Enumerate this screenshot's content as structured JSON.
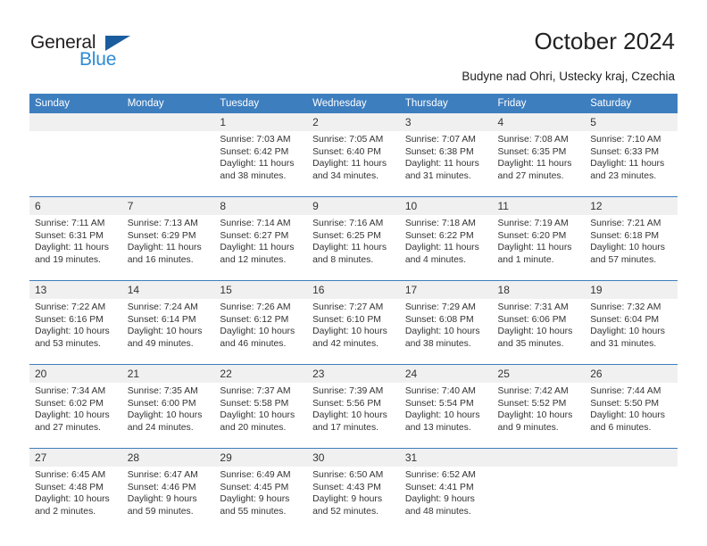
{
  "logo": {
    "word_top": "General",
    "word_bottom": "Blue",
    "triangle_color": "#1a5d9e",
    "blue_text_color": "#2e8bd4"
  },
  "header": {
    "title": "October 2024",
    "subtitle": "Budyne nad Ohri, Ustecky kraj, Czechia"
  },
  "theme": {
    "header_bg": "#3d7ebf",
    "date_strip_bg": "#f0f0f0",
    "text": "#333333"
  },
  "calendar": {
    "weekday_headers": [
      "Sunday",
      "Monday",
      "Tuesday",
      "Wednesday",
      "Thursday",
      "Friday",
      "Saturday"
    ],
    "weeks": [
      [
        {
          "day": "",
          "sunrise": "",
          "sunset": "",
          "daylight_1": "",
          "daylight_2": ""
        },
        {
          "day": "",
          "sunrise": "",
          "sunset": "",
          "daylight_1": "",
          "daylight_2": ""
        },
        {
          "day": "1",
          "sunrise": "Sunrise: 7:03 AM",
          "sunset": "Sunset: 6:42 PM",
          "daylight_1": "Daylight: 11 hours",
          "daylight_2": "and 38 minutes."
        },
        {
          "day": "2",
          "sunrise": "Sunrise: 7:05 AM",
          "sunset": "Sunset: 6:40 PM",
          "daylight_1": "Daylight: 11 hours",
          "daylight_2": "and 34 minutes."
        },
        {
          "day": "3",
          "sunrise": "Sunrise: 7:07 AM",
          "sunset": "Sunset: 6:38 PM",
          "daylight_1": "Daylight: 11 hours",
          "daylight_2": "and 31 minutes."
        },
        {
          "day": "4",
          "sunrise": "Sunrise: 7:08 AM",
          "sunset": "Sunset: 6:35 PM",
          "daylight_1": "Daylight: 11 hours",
          "daylight_2": "and 27 minutes."
        },
        {
          "day": "5",
          "sunrise": "Sunrise: 7:10 AM",
          "sunset": "Sunset: 6:33 PM",
          "daylight_1": "Daylight: 11 hours",
          "daylight_2": "and 23 minutes."
        }
      ],
      [
        {
          "day": "6",
          "sunrise": "Sunrise: 7:11 AM",
          "sunset": "Sunset: 6:31 PM",
          "daylight_1": "Daylight: 11 hours",
          "daylight_2": "and 19 minutes."
        },
        {
          "day": "7",
          "sunrise": "Sunrise: 7:13 AM",
          "sunset": "Sunset: 6:29 PM",
          "daylight_1": "Daylight: 11 hours",
          "daylight_2": "and 16 minutes."
        },
        {
          "day": "8",
          "sunrise": "Sunrise: 7:14 AM",
          "sunset": "Sunset: 6:27 PM",
          "daylight_1": "Daylight: 11 hours",
          "daylight_2": "and 12 minutes."
        },
        {
          "day": "9",
          "sunrise": "Sunrise: 7:16 AM",
          "sunset": "Sunset: 6:25 PM",
          "daylight_1": "Daylight: 11 hours",
          "daylight_2": "and 8 minutes."
        },
        {
          "day": "10",
          "sunrise": "Sunrise: 7:18 AM",
          "sunset": "Sunset: 6:22 PM",
          "daylight_1": "Daylight: 11 hours",
          "daylight_2": "and 4 minutes."
        },
        {
          "day": "11",
          "sunrise": "Sunrise: 7:19 AM",
          "sunset": "Sunset: 6:20 PM",
          "daylight_1": "Daylight: 11 hours",
          "daylight_2": "and 1 minute."
        },
        {
          "day": "12",
          "sunrise": "Sunrise: 7:21 AM",
          "sunset": "Sunset: 6:18 PM",
          "daylight_1": "Daylight: 10 hours",
          "daylight_2": "and 57 minutes."
        }
      ],
      [
        {
          "day": "13",
          "sunrise": "Sunrise: 7:22 AM",
          "sunset": "Sunset: 6:16 PM",
          "daylight_1": "Daylight: 10 hours",
          "daylight_2": "and 53 minutes."
        },
        {
          "day": "14",
          "sunrise": "Sunrise: 7:24 AM",
          "sunset": "Sunset: 6:14 PM",
          "daylight_1": "Daylight: 10 hours",
          "daylight_2": "and 49 minutes."
        },
        {
          "day": "15",
          "sunrise": "Sunrise: 7:26 AM",
          "sunset": "Sunset: 6:12 PM",
          "daylight_1": "Daylight: 10 hours",
          "daylight_2": "and 46 minutes."
        },
        {
          "day": "16",
          "sunrise": "Sunrise: 7:27 AM",
          "sunset": "Sunset: 6:10 PM",
          "daylight_1": "Daylight: 10 hours",
          "daylight_2": "and 42 minutes."
        },
        {
          "day": "17",
          "sunrise": "Sunrise: 7:29 AM",
          "sunset": "Sunset: 6:08 PM",
          "daylight_1": "Daylight: 10 hours",
          "daylight_2": "and 38 minutes."
        },
        {
          "day": "18",
          "sunrise": "Sunrise: 7:31 AM",
          "sunset": "Sunset: 6:06 PM",
          "daylight_1": "Daylight: 10 hours",
          "daylight_2": "and 35 minutes."
        },
        {
          "day": "19",
          "sunrise": "Sunrise: 7:32 AM",
          "sunset": "Sunset: 6:04 PM",
          "daylight_1": "Daylight: 10 hours",
          "daylight_2": "and 31 minutes."
        }
      ],
      [
        {
          "day": "20",
          "sunrise": "Sunrise: 7:34 AM",
          "sunset": "Sunset: 6:02 PM",
          "daylight_1": "Daylight: 10 hours",
          "daylight_2": "and 27 minutes."
        },
        {
          "day": "21",
          "sunrise": "Sunrise: 7:35 AM",
          "sunset": "Sunset: 6:00 PM",
          "daylight_1": "Daylight: 10 hours",
          "daylight_2": "and 24 minutes."
        },
        {
          "day": "22",
          "sunrise": "Sunrise: 7:37 AM",
          "sunset": "Sunset: 5:58 PM",
          "daylight_1": "Daylight: 10 hours",
          "daylight_2": "and 20 minutes."
        },
        {
          "day": "23",
          "sunrise": "Sunrise: 7:39 AM",
          "sunset": "Sunset: 5:56 PM",
          "daylight_1": "Daylight: 10 hours",
          "daylight_2": "and 17 minutes."
        },
        {
          "day": "24",
          "sunrise": "Sunrise: 7:40 AM",
          "sunset": "Sunset: 5:54 PM",
          "daylight_1": "Daylight: 10 hours",
          "daylight_2": "and 13 minutes."
        },
        {
          "day": "25",
          "sunrise": "Sunrise: 7:42 AM",
          "sunset": "Sunset: 5:52 PM",
          "daylight_1": "Daylight: 10 hours",
          "daylight_2": "and 9 minutes."
        },
        {
          "day": "26",
          "sunrise": "Sunrise: 7:44 AM",
          "sunset": "Sunset: 5:50 PM",
          "daylight_1": "Daylight: 10 hours",
          "daylight_2": "and 6 minutes."
        }
      ],
      [
        {
          "day": "27",
          "sunrise": "Sunrise: 6:45 AM",
          "sunset": "Sunset: 4:48 PM",
          "daylight_1": "Daylight: 10 hours",
          "daylight_2": "and 2 minutes."
        },
        {
          "day": "28",
          "sunrise": "Sunrise: 6:47 AM",
          "sunset": "Sunset: 4:46 PM",
          "daylight_1": "Daylight: 9 hours",
          "daylight_2": "and 59 minutes."
        },
        {
          "day": "29",
          "sunrise": "Sunrise: 6:49 AM",
          "sunset": "Sunset: 4:45 PM",
          "daylight_1": "Daylight: 9 hours",
          "daylight_2": "and 55 minutes."
        },
        {
          "day": "30",
          "sunrise": "Sunrise: 6:50 AM",
          "sunset": "Sunset: 4:43 PM",
          "daylight_1": "Daylight: 9 hours",
          "daylight_2": "and 52 minutes."
        },
        {
          "day": "31",
          "sunrise": "Sunrise: 6:52 AM",
          "sunset": "Sunset: 4:41 PM",
          "daylight_1": "Daylight: 9 hours",
          "daylight_2": "and 48 minutes."
        },
        {
          "day": "",
          "sunrise": "",
          "sunset": "",
          "daylight_1": "",
          "daylight_2": ""
        },
        {
          "day": "",
          "sunrise": "",
          "sunset": "",
          "daylight_1": "",
          "daylight_2": ""
        }
      ]
    ]
  }
}
